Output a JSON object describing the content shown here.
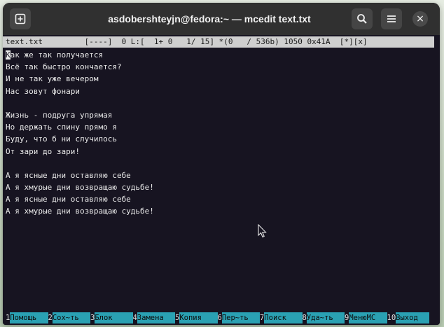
{
  "window": {
    "title": "asdobershteyjn@fedora:~ — mcedit text.txt",
    "newtab_icon": "plus-square-icon",
    "search_icon": "search-icon",
    "menu_icon": "hamburger-menu-icon",
    "close_glyph": "×"
  },
  "statusline": {
    "text": "text.txt         [----]  0 L:[  1+ 0   1/ 15] *(0   / 536b) 1050 0x41A  [*][x]"
  },
  "editor": {
    "cursor_char": "К",
    "first_line_rest": "ак же так получается",
    "lines": [
      "Всё так быстро кончается?",
      "И не так уже вечером",
      "Нас зовут фонари",
      "",
      "Жизнь - подруга упрямая",
      "Но держать спину прямо я",
      "Буду, что б ни случилось",
      "От зари до зари!",
      "",
      "А я ясные дни оставляю себе",
      "А я хмурые дни возвращаю судьбе!",
      "А я ясные дни оставляю себе",
      "А я хмурые дни возвращаю судьбе!"
    ]
  },
  "fkeys": [
    {
      "num": "1",
      "label": "Помощь"
    },
    {
      "num": "2",
      "label": "Сох~ть"
    },
    {
      "num": "3",
      "label": "Блок"
    },
    {
      "num": "4",
      "label": "Замена"
    },
    {
      "num": "5",
      "label": "Копия"
    },
    {
      "num": "6",
      "label": "Пер~ть"
    },
    {
      "num": "7",
      "label": "Поиск"
    },
    {
      "num": "8",
      "label": "Уда~ть"
    },
    {
      "num": "9",
      "label": "МенюМС"
    },
    {
      "num": "10",
      "label": "Выход"
    }
  ],
  "colors": {
    "terminal_bg": "#171421",
    "titlebar_bg": "#303030",
    "fkey_label_bg": "#2aa1b3",
    "statusline_bg": "#cfcfcf"
  }
}
